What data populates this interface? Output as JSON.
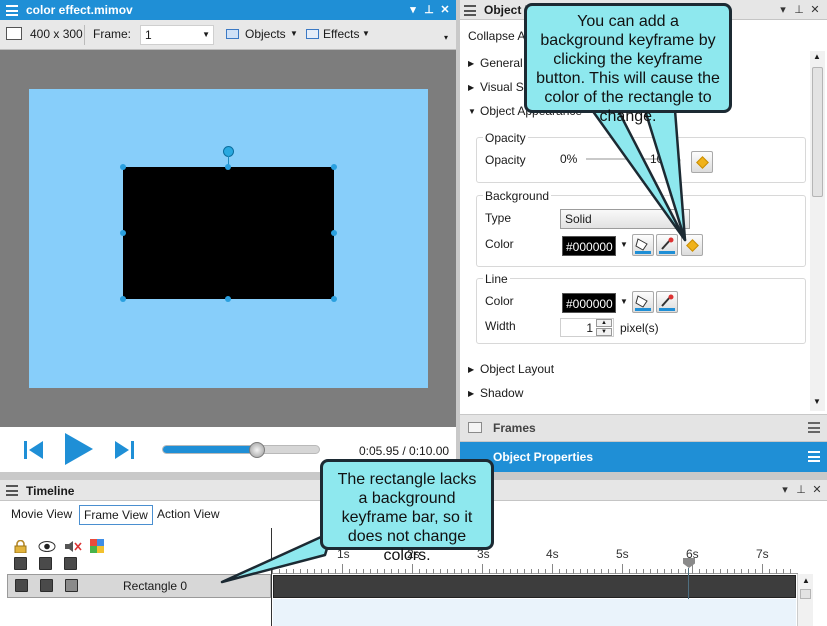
{
  "preview_panel": {
    "title": "color effect.mimov",
    "size_label": "400 x 300",
    "frame_label": "Frame:",
    "frame_value": "1",
    "objects_menu": "Objects",
    "effects_menu": "Effects",
    "time_display": "0:05.95 / 0:10.00",
    "scrub_progress": 0.6
  },
  "properties_panel": {
    "title": "Object Properties",
    "collapse_all": "Collapse All",
    "sections": {
      "general": "General",
      "visual": "Visual Settings",
      "appearance": "Object Appearance",
      "layout": "Object Layout",
      "shadow": "Shadow"
    },
    "opacity": {
      "group_title": "Opacity",
      "label": "Opacity",
      "min": "0%",
      "max": "100%"
    },
    "background": {
      "group_title": "Background",
      "type_label": "Type",
      "type_value": "Solid",
      "color_label": "Color",
      "color_value": "#000000"
    },
    "line": {
      "group_title": "Line",
      "color_label": "Color",
      "color_value": "#000000",
      "width_label": "Width",
      "width_value": "1",
      "width_unit": "pixel(s)"
    },
    "frames_tab": "Frames",
    "properties_tab": "Object Properties"
  },
  "timeline_panel": {
    "title": "Timeline",
    "tabs": [
      "Movie View",
      "Frame View",
      "Action View"
    ],
    "active_tab": "Frame View",
    "row_label": "Rectangle 0",
    "ticks": [
      "1s",
      "2s",
      "3s",
      "4s",
      "5s",
      "6s",
      "7s"
    ]
  },
  "callouts": {
    "top": "You can add a background keyframe by clicking the keyframe button. This will cause the color of the rectangle to change.",
    "bottom": "The rectangle lacks a background keyframe bar, so it does not change colors."
  },
  "colors": {
    "accent": "#1f8fd6",
    "stage": "#87cefa",
    "shape": "#000000",
    "callout": "#8ee8ee",
    "keyframe": "#f0b21a"
  }
}
